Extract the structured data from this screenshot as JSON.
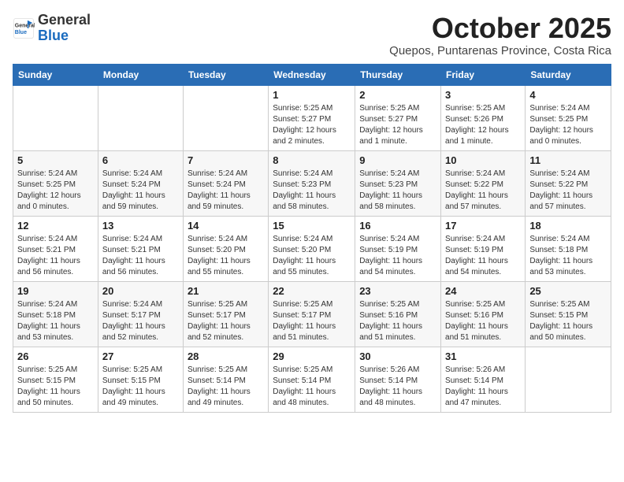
{
  "header": {
    "logo": {
      "text_general": "General",
      "text_blue": "Blue"
    },
    "title": "October 2025",
    "subtitle": "Quepos, Puntarenas Province, Costa Rica"
  },
  "weekdays": [
    "Sunday",
    "Monday",
    "Tuesday",
    "Wednesday",
    "Thursday",
    "Friday",
    "Saturday"
  ],
  "weeks": [
    [
      {
        "day": "",
        "sunrise": "",
        "sunset": "",
        "daylight": ""
      },
      {
        "day": "",
        "sunrise": "",
        "sunset": "",
        "daylight": ""
      },
      {
        "day": "",
        "sunrise": "",
        "sunset": "",
        "daylight": ""
      },
      {
        "day": "1",
        "sunrise": "5:25 AM",
        "sunset": "5:27 PM",
        "daylight": "12 hours and 2 minutes."
      },
      {
        "day": "2",
        "sunrise": "5:25 AM",
        "sunset": "5:27 PM",
        "daylight": "12 hours and 1 minute."
      },
      {
        "day": "3",
        "sunrise": "5:25 AM",
        "sunset": "5:26 PM",
        "daylight": "12 hours and 1 minute."
      },
      {
        "day": "4",
        "sunrise": "5:24 AM",
        "sunset": "5:25 PM",
        "daylight": "12 hours and 0 minutes."
      }
    ],
    [
      {
        "day": "5",
        "sunrise": "5:24 AM",
        "sunset": "5:25 PM",
        "daylight": "12 hours and 0 minutes."
      },
      {
        "day": "6",
        "sunrise": "5:24 AM",
        "sunset": "5:24 PM",
        "daylight": "11 hours and 59 minutes."
      },
      {
        "day": "7",
        "sunrise": "5:24 AM",
        "sunset": "5:24 PM",
        "daylight": "11 hours and 59 minutes."
      },
      {
        "day": "8",
        "sunrise": "5:24 AM",
        "sunset": "5:23 PM",
        "daylight": "11 hours and 58 minutes."
      },
      {
        "day": "9",
        "sunrise": "5:24 AM",
        "sunset": "5:23 PM",
        "daylight": "11 hours and 58 minutes."
      },
      {
        "day": "10",
        "sunrise": "5:24 AM",
        "sunset": "5:22 PM",
        "daylight": "11 hours and 57 minutes."
      },
      {
        "day": "11",
        "sunrise": "5:24 AM",
        "sunset": "5:22 PM",
        "daylight": "11 hours and 57 minutes."
      }
    ],
    [
      {
        "day": "12",
        "sunrise": "5:24 AM",
        "sunset": "5:21 PM",
        "daylight": "11 hours and 56 minutes."
      },
      {
        "day": "13",
        "sunrise": "5:24 AM",
        "sunset": "5:21 PM",
        "daylight": "11 hours and 56 minutes."
      },
      {
        "day": "14",
        "sunrise": "5:24 AM",
        "sunset": "5:20 PM",
        "daylight": "11 hours and 55 minutes."
      },
      {
        "day": "15",
        "sunrise": "5:24 AM",
        "sunset": "5:20 PM",
        "daylight": "11 hours and 55 minutes."
      },
      {
        "day": "16",
        "sunrise": "5:24 AM",
        "sunset": "5:19 PM",
        "daylight": "11 hours and 54 minutes."
      },
      {
        "day": "17",
        "sunrise": "5:24 AM",
        "sunset": "5:19 PM",
        "daylight": "11 hours and 54 minutes."
      },
      {
        "day": "18",
        "sunrise": "5:24 AM",
        "sunset": "5:18 PM",
        "daylight": "11 hours and 53 minutes."
      }
    ],
    [
      {
        "day": "19",
        "sunrise": "5:24 AM",
        "sunset": "5:18 PM",
        "daylight": "11 hours and 53 minutes."
      },
      {
        "day": "20",
        "sunrise": "5:24 AM",
        "sunset": "5:17 PM",
        "daylight": "11 hours and 52 minutes."
      },
      {
        "day": "21",
        "sunrise": "5:25 AM",
        "sunset": "5:17 PM",
        "daylight": "11 hours and 52 minutes."
      },
      {
        "day": "22",
        "sunrise": "5:25 AM",
        "sunset": "5:17 PM",
        "daylight": "11 hours and 51 minutes."
      },
      {
        "day": "23",
        "sunrise": "5:25 AM",
        "sunset": "5:16 PM",
        "daylight": "11 hours and 51 minutes."
      },
      {
        "day": "24",
        "sunrise": "5:25 AM",
        "sunset": "5:16 PM",
        "daylight": "11 hours and 51 minutes."
      },
      {
        "day": "25",
        "sunrise": "5:25 AM",
        "sunset": "5:15 PM",
        "daylight": "11 hours and 50 minutes."
      }
    ],
    [
      {
        "day": "26",
        "sunrise": "5:25 AM",
        "sunset": "5:15 PM",
        "daylight": "11 hours and 50 minutes."
      },
      {
        "day": "27",
        "sunrise": "5:25 AM",
        "sunset": "5:15 PM",
        "daylight": "11 hours and 49 minutes."
      },
      {
        "day": "28",
        "sunrise": "5:25 AM",
        "sunset": "5:14 PM",
        "daylight": "11 hours and 49 minutes."
      },
      {
        "day": "29",
        "sunrise": "5:25 AM",
        "sunset": "5:14 PM",
        "daylight": "11 hours and 48 minutes."
      },
      {
        "day": "30",
        "sunrise": "5:26 AM",
        "sunset": "5:14 PM",
        "daylight": "11 hours and 48 minutes."
      },
      {
        "day": "31",
        "sunrise": "5:26 AM",
        "sunset": "5:14 PM",
        "daylight": "11 hours and 47 minutes."
      },
      {
        "day": "",
        "sunrise": "",
        "sunset": "",
        "daylight": ""
      }
    ]
  ]
}
